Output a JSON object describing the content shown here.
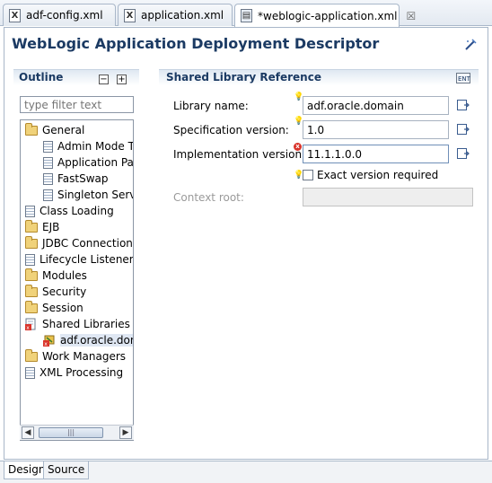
{
  "tabs": [
    {
      "label": "adf-config.xml",
      "icon": "xml-file-icon",
      "active": false
    },
    {
      "label": "application.xml",
      "icon": "xml-file-icon",
      "active": false
    },
    {
      "label": "*weblogic-application.xml",
      "icon": "descriptor-file-icon",
      "active": true,
      "close": "☒"
    }
  ],
  "header": {
    "title": "WebLogic Application Deployment Descriptor",
    "icon": "wand-icon"
  },
  "outline": {
    "title": "Outline",
    "filter_placeholder": "type filter text",
    "items": [
      {
        "label": "General",
        "icon": "folder-icon",
        "level": 0
      },
      {
        "label": "Admin Mode T",
        "icon": "page-icon",
        "level": 1
      },
      {
        "label": "Application Par",
        "icon": "page-icon",
        "level": 1
      },
      {
        "label": "FastSwap",
        "icon": "page-icon",
        "level": 1
      },
      {
        "label": "Singleton Servi",
        "icon": "page-icon",
        "level": 1
      },
      {
        "label": "Class Loading",
        "icon": "page-icon",
        "level": 0
      },
      {
        "label": "EJB",
        "icon": "folder-icon",
        "level": 0
      },
      {
        "label": "JDBC Connection P",
        "icon": "folder-icon",
        "level": 0
      },
      {
        "label": "Lifecycle Listeners",
        "icon": "page-icon",
        "level": 0
      },
      {
        "label": "Modules",
        "icon": "folder-icon",
        "level": 0
      },
      {
        "label": "Security",
        "icon": "folder-icon",
        "level": 0
      },
      {
        "label": "Session",
        "icon": "folder-icon",
        "level": 0
      },
      {
        "label": "Shared Libraries",
        "icon": "shared-libraries-error-icon",
        "level": 0
      },
      {
        "label": "adf.oracle.dom",
        "icon": "library-error-icon",
        "level": 1,
        "selected": true
      },
      {
        "label": "Work Managers",
        "icon": "folder-icon",
        "level": 0
      },
      {
        "label": "XML Processing",
        "icon": "page-icon",
        "level": 0
      }
    ]
  },
  "details": {
    "title": "Shared Library Reference",
    "library_name_label": "Library name:",
    "library_name_value": "adf.oracle.domain",
    "spec_version_label": "Specification version:",
    "spec_version_value": "1.0",
    "impl_version_label": "Implementation version:",
    "impl_version_value": "11.1.1.0.0",
    "exact_version_label": "Exact version required",
    "exact_version_checked": false,
    "context_root_label": "Context root:",
    "context_root_value": ""
  },
  "bottom_tabs": [
    {
      "label": "Design",
      "active": true
    },
    {
      "label": "Source",
      "active": false
    }
  ]
}
